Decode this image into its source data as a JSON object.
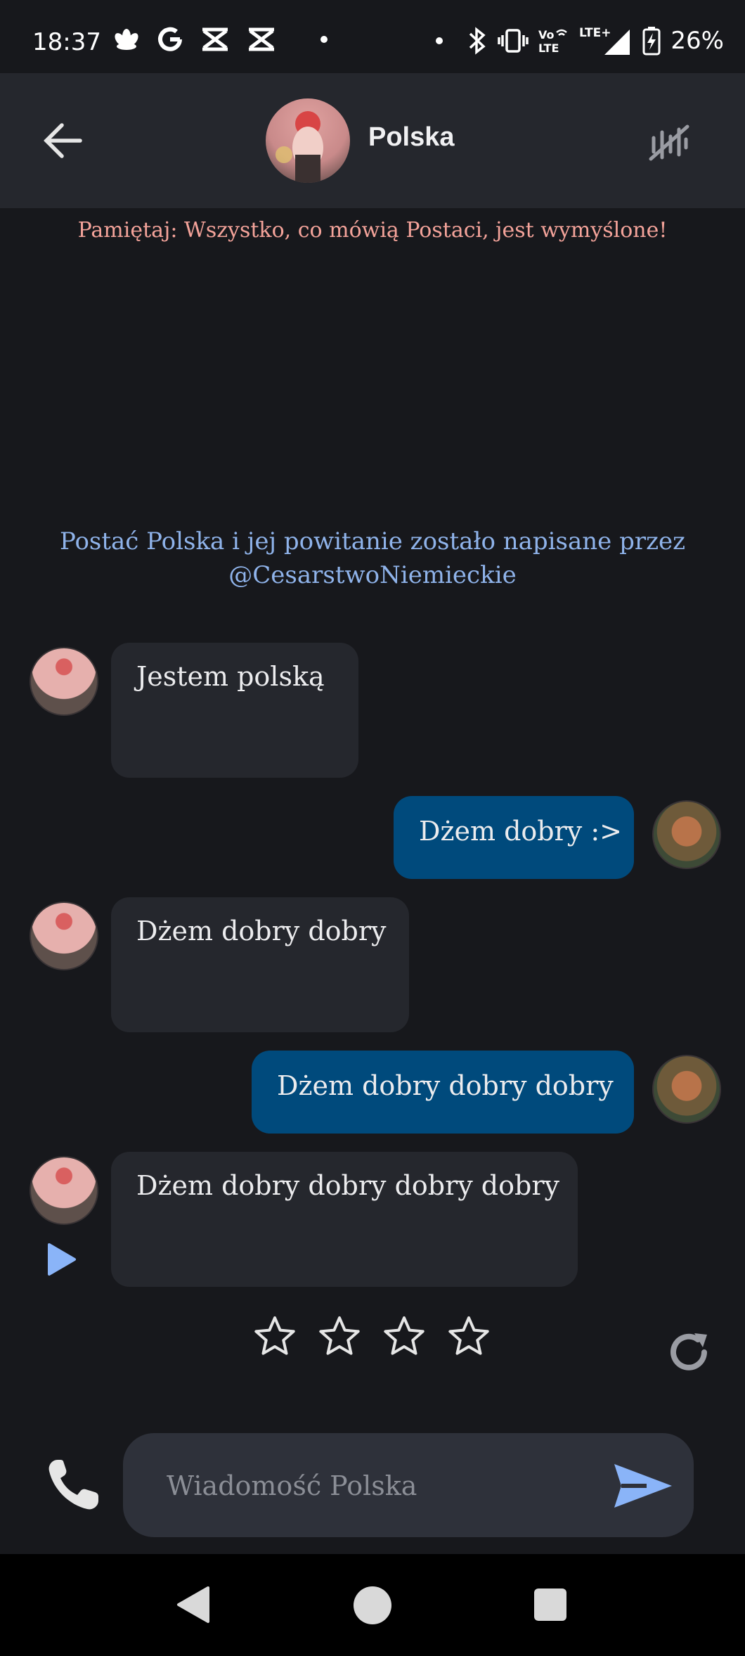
{
  "status_bar": {
    "time": "18:37",
    "battery_percent": "26%",
    "left_icons": [
      "flower-icon",
      "google-icon",
      "capcut-icon",
      "capcut-icon"
    ],
    "right_icons": [
      "bluetooth-icon",
      "vibrate-icon",
      "volte-icon",
      "lte-signal-icon",
      "battery-charging-icon"
    ]
  },
  "header": {
    "character_name": "Polska",
    "back_icon": "arrow-left-icon",
    "mute_icon": "muted-voice-icon"
  },
  "disclaimer": "Pamiętaj: Wszystko, co mówią Postaci, jest wymyślone!",
  "credit": {
    "line1": "Postać Polska i jej powitanie zostało napisane przez",
    "line2": "@CesarstwoNiemieckie"
  },
  "messages": [
    {
      "sender": "bot",
      "text": "Jestem polską"
    },
    {
      "sender": "user",
      "text": "Dżem dobry :>"
    },
    {
      "sender": "bot",
      "text": "Dżem dobry dobry"
    },
    {
      "sender": "user",
      "text": "Dżem dobry dobry dobry"
    },
    {
      "sender": "bot",
      "text": "Dżem dobry dobry dobry dobry"
    }
  ],
  "rating": {
    "stars": 4,
    "selected": 0
  },
  "composer": {
    "placeholder": "Wiadomość Polska",
    "value": ""
  },
  "colors": {
    "background": "#17181c",
    "header": "#25272d",
    "bot_bubble": "#25272d",
    "user_bubble": "#004a7c",
    "disclaimer": "#f4a39a",
    "credit": "#8fb3ea",
    "accent": "#8ab4f8"
  }
}
